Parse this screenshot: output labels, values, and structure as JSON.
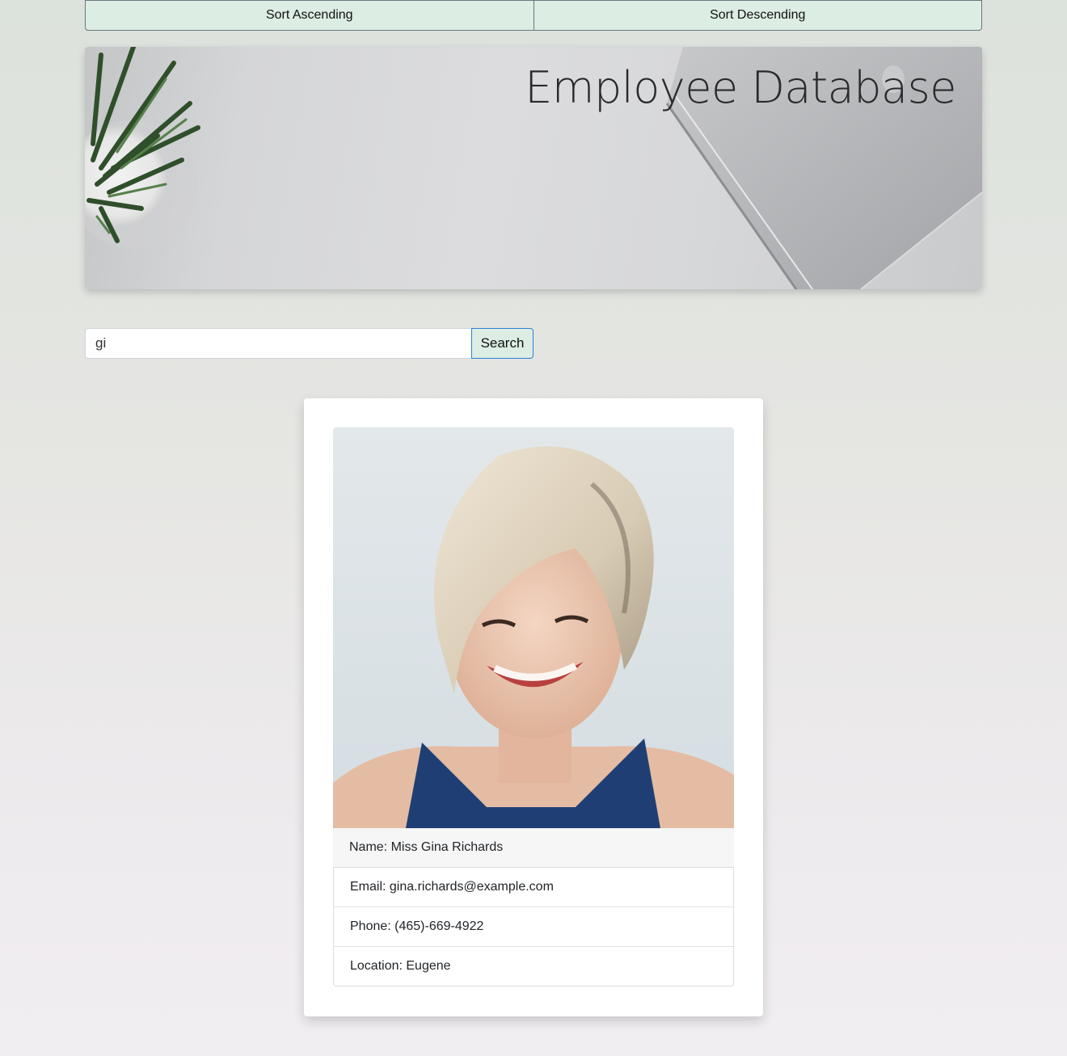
{
  "toolbar": {
    "sort_ascending_label": "Sort Ascending",
    "sort_descending_label": "Sort Descending"
  },
  "header": {
    "title": "Employee Database"
  },
  "search": {
    "value": "gi",
    "button_label": "Search"
  },
  "employee_card": {
    "name": "Name: Miss Gina Richards",
    "email": "Email: gina.richards@example.com",
    "phone": "Phone: (465)-669-4922",
    "location": "Location: Eugene"
  },
  "colors": {
    "button_background": "#dcede3",
    "search_button_border": "#2f7fd6",
    "card_background": "#ffffff",
    "name_row_background": "#f6f6f6"
  }
}
